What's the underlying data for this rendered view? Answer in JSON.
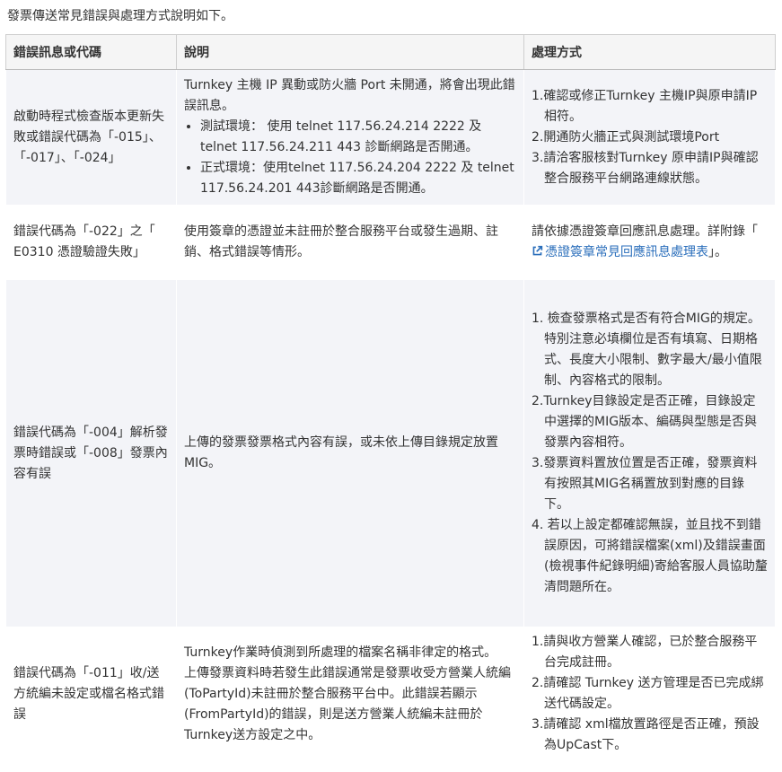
{
  "intro": "發票傳送常見錯誤與處理方式說明如下。",
  "headers": [
    "錯誤訊息或代碼",
    "說明",
    "處理方式"
  ],
  "rows": [
    {
      "code": "啟動時程式檢查版本更新失敗或錯誤代碼為「-015」、「-017」、「-024」",
      "desc_text": "Turnkey 主機 IP 異動或防火牆 Port 未開通，將會出現此錯誤訊息。",
      "desc_bullets": [
        "測試環境： 使用 telnet 117.56.24.214 2222 及 telnet 117.56.24.211 443 診斷網路是否開通。",
        "正式環境：使用telnet 117.56.24.204 2222 及 telnet 117.56.24.201 443診斷網路是否開通。"
      ],
      "steps": [
        "1.確認或修正Turnkey 主機IP與原申請IP 相符。",
        "2.開通防火牆正式與測試環境Port",
        "3.請洽客服核對Turnkey 原申請IP與確認整合服務平台網路連線狀態。"
      ]
    },
    {
      "code": "錯誤代碼為「-022」之「 E0310 憑證驗證失敗」",
      "desc_text": "使用簽章的憑證並未註冊於整合服務平台或發生過期、註銷、格式錯誤等情形。",
      "action_prefix": "請依據憑證簽章回應訊息處理。詳附錄「",
      "action_link": "憑證簽章常見回應訊息處理表",
      "action_suffix": "」。"
    },
    {
      "code": "錯誤代碼為「-004」解析發票時錯誤或「-008」發票內容有誤",
      "desc_text": "上傳的發票發票格式內容有誤，或未依上傳目錄規定放置MIG。",
      "steps": [
        "1. 檢查發票格式是否有符合MIG的規定。特別注意必填欄位是否有填寫、日期格式、長度大小限制、數字最大/最小值限制、內容格式的限制。",
        "2.Turnkey目錄設定是否正確，目錄設定中選擇的MIG版本、編碼與型態是否與發票內容相符。",
        "3.發票資料置放位置是否正確，發票資料有按照其MIG名稱置放到對應的目錄下。",
        "4. 若以上設定都確認無誤，並且找不到錯誤原因，可將錯誤檔案(xml)及錯誤畫面(檢視事件紀錄明細)寄給客服人員協助釐清問題所在。"
      ]
    },
    {
      "code": "錯誤代碼為「-011」收/送方統編未設定或檔名格式錯誤",
      "desc_lines": [
        "Turnkey作業時偵測到所處理的檔案名稱非律定的格式。",
        "上傳發票資料時若發生此錯誤通常是發票收受方營業人統編(ToPartyId)未註冊於整合服務平台中。此錯誤若顯示(FromPartyId)的錯誤，則是送方營業人統編未註冊於Turnkey送方設定之中。"
      ],
      "steps": [
        "1.請與收方營業人確認，已於整合服務平台完成註冊。",
        "2.請確認 Turnkey 送方管理是否已完成綁送代碼設定。",
        "3.請確認 xml檔放置路徑是否正確，預設為UpCast下。"
      ]
    }
  ]
}
